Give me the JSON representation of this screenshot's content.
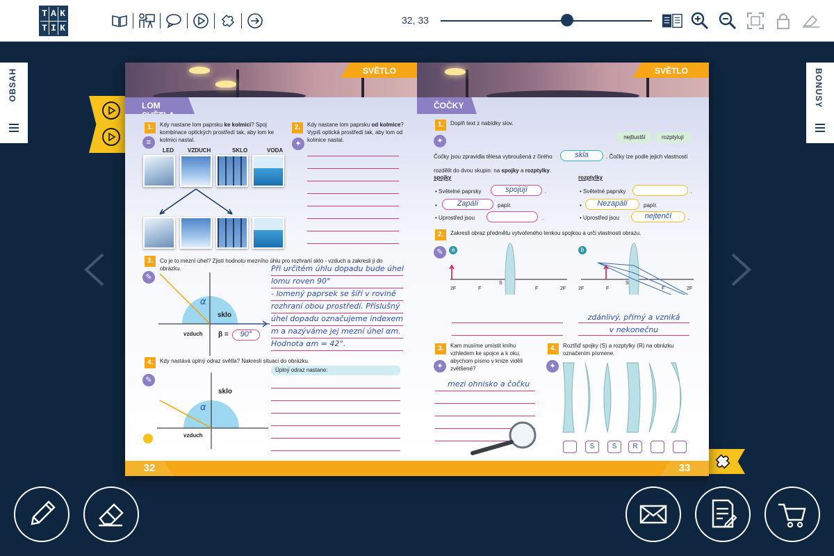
{
  "toolbar": {
    "logo_letters": [
      "T",
      "A",
      "K",
      "T",
      "I",
      "K"
    ],
    "page_indicator": "32, 33",
    "slider_position": 0.6
  },
  "side_tabs": {
    "left_label": "OBSAH",
    "right_label": "BONUSY"
  },
  "left_page": {
    "subject": "SVĚTLO",
    "section": "LOM SVĚTLA",
    "page_number": "32",
    "q1": {
      "num": "1.",
      "text_before": "Kdy nastane lom paprsku ",
      "text_bold": "ke kolmici",
      "text_after": "? Spoj kombinace optických prostředí tak, aby lom ke kolmici nastal.",
      "labels": [
        "LED",
        "VZDUCH",
        "SKLO",
        "VODA"
      ]
    },
    "q2": {
      "num": "2.",
      "text_before": "Kdy nastane lom paprsku ",
      "text_bold": "od kolmice",
      "text_after": "? Vypiš optická prostředí tak, aby lom od kolmice nastal."
    },
    "q3": {
      "num": "3.",
      "text": "Co je to mezní úhel? Zjisti hodnotu mezního úhlu pro rozhraní sklo - vzduch a zakresli ji do obrázku.",
      "diagram_sklo": "sklo",
      "diagram_vzduch": "vzduch",
      "diagram_alpha": "α",
      "beta_label": "β =",
      "beta_value": "90°",
      "handwriting": [
        "Při určitém úhlu dopadu bude úhel",
        "lomu roven 90°",
        "- lomený paprsek se šíří v rovině",
        "rozhraní obou prostředí. Příslušný",
        "úhel dopadu označujeme indexem",
        "m a nazýváme jej mezní úhel αm.",
        "Hodnota αm = 42°."
      ]
    },
    "q4": {
      "num": "4.",
      "text": "Kdy nastává úplný odraz světla? Nakresli situaci do obrázku.",
      "answer_label": "Úplný odraz nastane:",
      "diagram_sklo": "sklo",
      "diagram_vzduch": "vzduch",
      "diagram_alpha": "α"
    }
  },
  "right_page": {
    "subject": "SVĚTLO",
    "section": "ČOČKY",
    "page_number": "33",
    "q1": {
      "num": "1.",
      "text": "Doplň text z nabídky slov.",
      "chips": [
        "nejtlustší",
        "rozptylují"
      ],
      "sentence1": "Čočky jsou zpravidla tělesa vybroušená z čirého",
      "answer_skla": "skla",
      "sentence1_end": ". Čočky lze podle jejich vlastností",
      "sentence2_before": "rozdělit do dvou skupin: na ",
      "sentence2_bold1": "spojky",
      "sentence2_mid": " a ",
      "sentence2_bold2": "rozptylky",
      "sentence2_end": ".",
      "spojky_title": "spojky",
      "rozptylky_title": "rozptylky",
      "spojky_rows": [
        {
          "before": "• Světelné paprsky",
          "answer": "spojují",
          "after": "."
        },
        {
          "before": "•",
          "answer": "Zapálí",
          "after": "papír."
        },
        {
          "before": "• Uprostřed jsou",
          "answer": "",
          "after": "."
        }
      ],
      "rozptylky_rows": [
        {
          "before": "• Světelné paprsky",
          "answer": "",
          "after": "."
        },
        {
          "before": "•",
          "answer": "Nezapálí",
          "after": "papír."
        },
        {
          "before": "• Uprostřed jsou",
          "answer": "nejtenčí",
          "after": "."
        }
      ]
    },
    "q2": {
      "num": "2.",
      "text": "Zakresli obraz předmětu vytvořeného tenkou spojkou a urči vlastnosti obrazu.",
      "marker_a": "a",
      "marker_b": "b",
      "axis_labels": [
        "2F",
        "F",
        "S",
        "F",
        "2F"
      ],
      "answer_b": [
        "zdánlivý, přímý a vzniká",
        "v nekonečnu"
      ]
    },
    "q3": {
      "num": "3.",
      "text": "Kam musíme umístit knihu vzhledem ke spojce a k oku, abychom písmo v knize viděli zvětšené?",
      "answer": "mezi ohnisko a čočku"
    },
    "q4": {
      "num": "4.",
      "text": "Roztřiď spojky (S) a rozptylky (R) na obrázku označením písmene.",
      "answers": [
        "",
        "S",
        "S",
        "R",
        "",
        ""
      ]
    }
  },
  "colors": {
    "navy": "#1d3a5c",
    "background": "#0f2640",
    "accent_orange": "#f7a615",
    "section_purple": "#8d7fc4",
    "answer_blue": "#2b4eab",
    "line_pink": "#cf3c77"
  },
  "icons": {
    "toolbar": [
      "book-icon",
      "presentation-icon",
      "comment-icon",
      "play-icon",
      "puzzle-icon",
      "exit-icon"
    ],
    "right_toolbar": [
      "double-page-icon",
      "zoom-in-icon",
      "zoom-out-icon",
      "fullscreen-icon",
      "lock-icon",
      "clear-icon"
    ],
    "bottom_buttons": [
      "pencil-icon",
      "eraser-icon",
      "mail-icon",
      "notes-icon",
      "cart-icon"
    ]
  }
}
